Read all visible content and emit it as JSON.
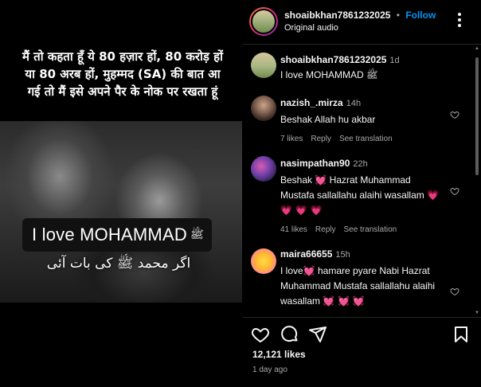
{
  "video": {
    "hindi_caption": "मैं तो कहता हूँ ये 80 हज़ार हों, 80 करोड़ हों या 80 अरब हों, मुहम्मद (SA) की बात आ गई तो मैं इसे अपने पैर के नोक पर रखता हूं",
    "love_text": "I love MOHAMMAD",
    "pbuh_glyph": "ﷺ",
    "urdu_caption": "اگر محمد ﷺ کی بات آئی"
  },
  "header": {
    "username": "shoaibkhan7861232025",
    "separator": "•",
    "follow_label": "Follow",
    "subtitle": "Original audio"
  },
  "comments": [
    {
      "username": "shoaibkhan7861232025",
      "time": "1d",
      "text": "I love MOHAMMAD ﷺ",
      "meta": null
    },
    {
      "username": "nazish_.mirza",
      "time": "14h",
      "text": "Beshak Allah hu akbar",
      "likes": "7 likes",
      "reply": "Reply",
      "translate": "See translation"
    },
    {
      "username": "nasimpathan90",
      "time": "22h",
      "text_parts": [
        "Beshak ",
        " Hazrat Muhammad Mustafa sallallahu alaihi wasallam "
      ],
      "likes": "41 likes",
      "reply": "Reply",
      "translate": "See translation"
    },
    {
      "username": "maira66655",
      "time": "15h",
      "text_parts": [
        "I love",
        " hamare pyare Nabi Hazrat Muhammad Mustafa sallallahu alaihi wasallam "
      ]
    }
  ],
  "footer": {
    "likes": "12,121 likes",
    "posted": "1 day ago"
  },
  "icons": [
    "more-icon",
    "heart-icon",
    "comment-icon",
    "share-icon",
    "bookmark-icon"
  ],
  "colors": {
    "accent": "#0095f6",
    "heart": "#ff2d55",
    "muted": "#a8a8a8"
  }
}
